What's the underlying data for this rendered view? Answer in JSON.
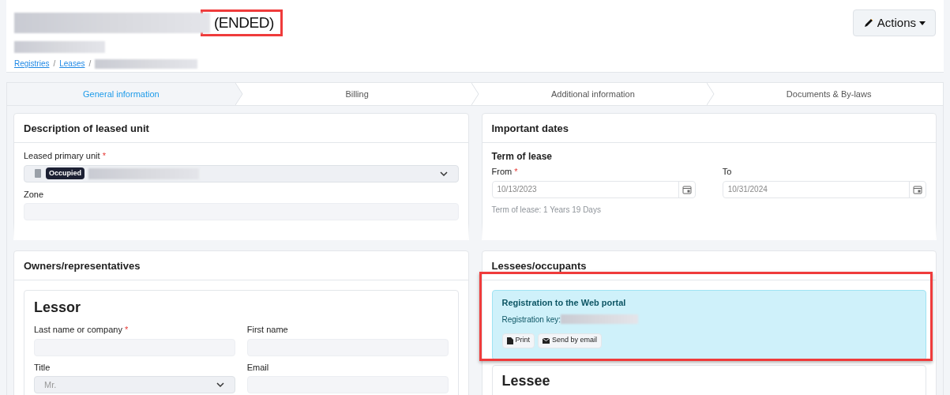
{
  "header": {
    "status": "(ENDED)",
    "breadcrumbs": [
      {
        "label": "Registries",
        "separator": "/"
      },
      {
        "label": "Leases",
        "separator": "/"
      }
    ],
    "actions_button": "Actions"
  },
  "required_mark": "*",
  "tabs": [
    {
      "label": "General information",
      "selected": true
    },
    {
      "label": "Billing",
      "selected": false
    },
    {
      "label": "Additional information",
      "selected": false
    },
    {
      "label": "Documents & By-laws",
      "selected": false
    }
  ],
  "leased_unit": {
    "title": "Description of leased unit",
    "unit_label": "Leased primary unit",
    "unit_required": true,
    "unit_badge": "Occupied",
    "zone_label": "Zone"
  },
  "dates": {
    "title": "Important dates",
    "subtitle": "Term of lease",
    "from_label": "From",
    "from_required": true,
    "from_value": "10/13/2023",
    "to_label": "To",
    "to_value": "10/31/2024",
    "duration": "Term of lease: 1 Years 19 Days"
  },
  "owners": {
    "title": "Owners/representatives",
    "lessor_title": "Lessor",
    "fields": [
      {
        "label": "Last name or company",
        "required": true,
        "kind": "text"
      },
      {
        "label": "First name",
        "required": false,
        "kind": "text"
      },
      {
        "label": "Title",
        "required": false,
        "kind": "select",
        "value": "Mr."
      },
      {
        "label": "Email",
        "required": false,
        "kind": "text"
      }
    ]
  },
  "lessees": {
    "title": "Lessees/occupants",
    "portal_title": "Registration to the Web portal",
    "key_label": "Registration key:",
    "buttons": [
      {
        "label": "Print",
        "kind": "print"
      },
      {
        "label": "Send by email",
        "kind": "email"
      }
    ],
    "lessee_title": "Lessee"
  }
}
